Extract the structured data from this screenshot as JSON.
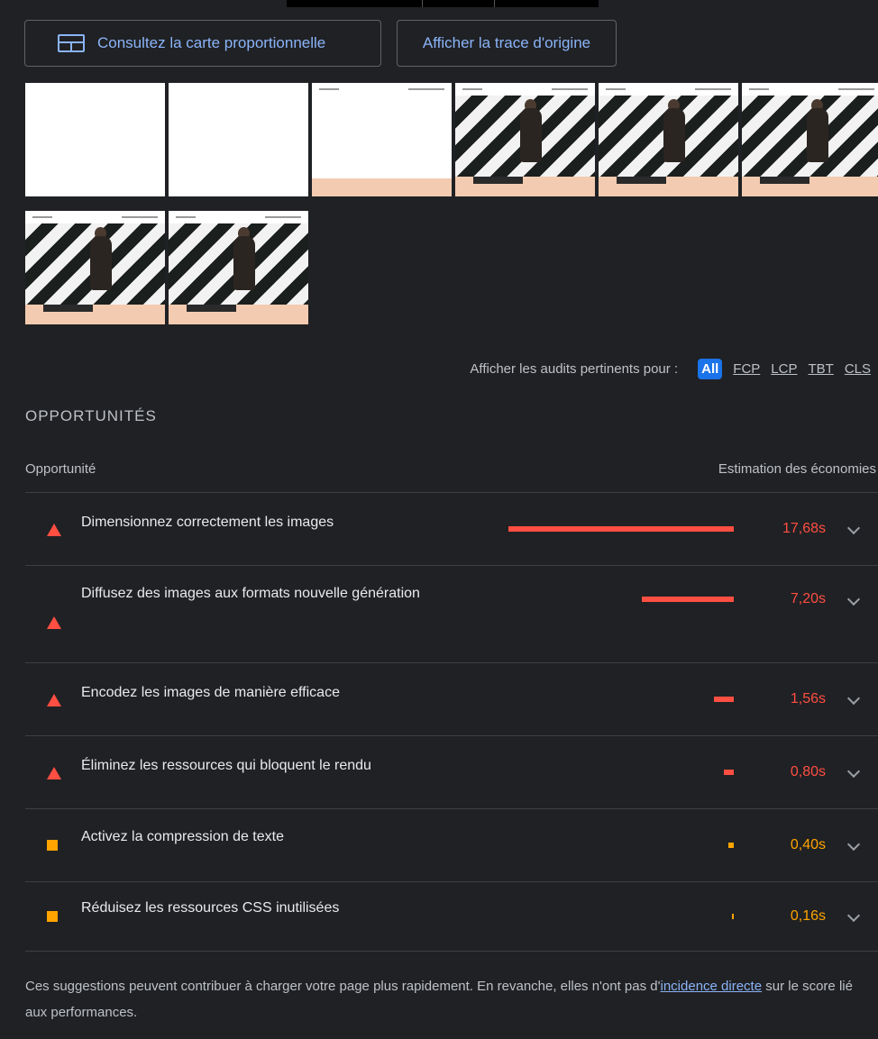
{
  "toolbar": {
    "treemap_label": "Consultez la carte proportionnelle",
    "trace_label": "Afficher la trace d'origine"
  },
  "filmstrip": {
    "frames": [
      "blank",
      "blank",
      "loading",
      "loaded",
      "loaded",
      "loaded",
      "loaded",
      "loaded"
    ]
  },
  "filter": {
    "prefix": "Afficher les audits pertinents pour :",
    "chips": [
      "All",
      "FCP",
      "LCP",
      "TBT",
      "CLS"
    ],
    "active": "All"
  },
  "opportunities": {
    "section_title": "OPPORTUNITÉS",
    "col_opportunity": "Opportunité",
    "col_savings": "Estimation des économies",
    "items": [
      {
        "title": "Dimensionnez correctement les images",
        "savings": "17,68s",
        "severity": "fail",
        "savings_seconds": 17.68
      },
      {
        "title": "Diffusez des images aux formats nouvelle génération",
        "savings": "7,20s",
        "severity": "fail",
        "savings_seconds": 7.2
      },
      {
        "title": "Encodez les images de manière efficace",
        "savings": "1,56s",
        "severity": "fail",
        "savings_seconds": 1.56
      },
      {
        "title": "Éliminez les ressources qui bloquent le rendu",
        "savings": "0,80s",
        "severity": "fail",
        "savings_seconds": 0.8
      },
      {
        "title": "Activez la compression de texte",
        "savings": "0,40s",
        "severity": "average",
        "savings_seconds": 0.4
      },
      {
        "title": "Réduisez les ressources CSS inutilisées",
        "savings": "0,16s",
        "severity": "average",
        "savings_seconds": 0.16
      }
    ]
  },
  "note": {
    "text_before": "Ces suggestions peuvent contribuer à charger votre page plus rapidement. En revanche, elles n'ont pas d'",
    "link": "incidence directe",
    "text_after": " sur le score lié aux performances."
  },
  "colors": {
    "fail": "#ff4e42",
    "average": "#ffa400",
    "link": "#8ab4f8",
    "background": "#202124"
  }
}
